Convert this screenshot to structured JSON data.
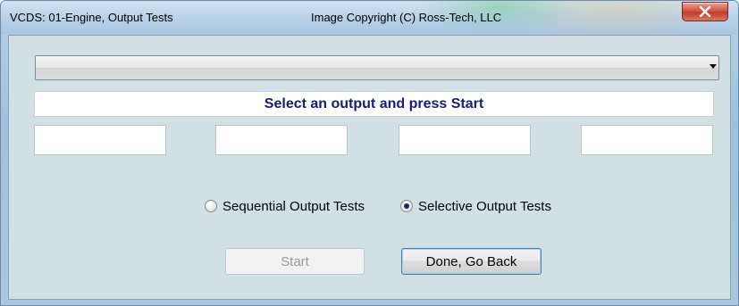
{
  "window": {
    "title": "VCDS: 01-Engine,  Output Tests",
    "copyright": "Image Copyright (C) Ross-Tech, LLC"
  },
  "output_select": {
    "value": ""
  },
  "instruction": "Select an output and press Start",
  "fields": [
    "",
    "",
    "",
    ""
  ],
  "modes": [
    {
      "label": "Sequential Output Tests",
      "selected": false
    },
    {
      "label": "Selective Output Tests",
      "selected": true
    }
  ],
  "buttons": {
    "start": "Start",
    "done": "Done, Go Back"
  },
  "icons": {
    "close": "close-icon",
    "dropdown": "chevron-down-icon"
  },
  "colors": {
    "instruction_text": "#1a1a7a",
    "close_button": "#c23c26",
    "dialog_background": "#d3e0e3"
  }
}
